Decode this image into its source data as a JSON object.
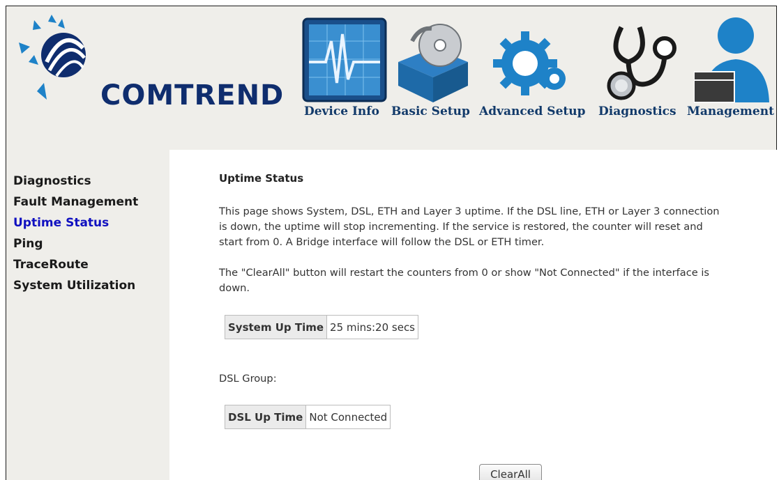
{
  "brand": {
    "name": "COMTREND",
    "primary_color": "#0f2d6e",
    "accent_color": "#1e82c8"
  },
  "nav": [
    {
      "label": "Device Info",
      "icon": "heartbeat-monitor-icon"
    },
    {
      "label": "Basic Setup",
      "icon": "setup-box-disc-icon"
    },
    {
      "label": "Advanced Setup",
      "icon": "gears-icon"
    },
    {
      "label": "Diagnostics",
      "icon": "stethoscope-icon"
    },
    {
      "label": "Management",
      "icon": "user-management-icon"
    }
  ],
  "sidebar": {
    "items": [
      {
        "label": "Diagnostics"
      },
      {
        "label": "Fault Management"
      },
      {
        "label": "Uptime Status"
      },
      {
        "label": "Ping"
      },
      {
        "label": "TraceRoute"
      },
      {
        "label": "System Utilization"
      }
    ],
    "active": "Uptime Status"
  },
  "main": {
    "title": "Uptime Status",
    "paragraph1": "This page shows System, DSL, ETH and Layer 3 uptime. If the DSL line, ETH or Layer 3 connection is down, the uptime will stop incrementing. If the service is restored, the counter will reset and start from 0. A Bridge interface will follow the DSL or ETH timer.",
    "paragraph2": "The \"ClearAll\" button will restart the counters from 0 or show \"Not Connected\" if the interface is down.",
    "system": {
      "label": "System Up Time",
      "value": "25 mins:20 secs"
    },
    "dsl_group_label": "DSL Group:",
    "dsl": {
      "label": "DSL Up Time",
      "value": "Not Connected"
    },
    "clear_button": "ClearAll"
  }
}
